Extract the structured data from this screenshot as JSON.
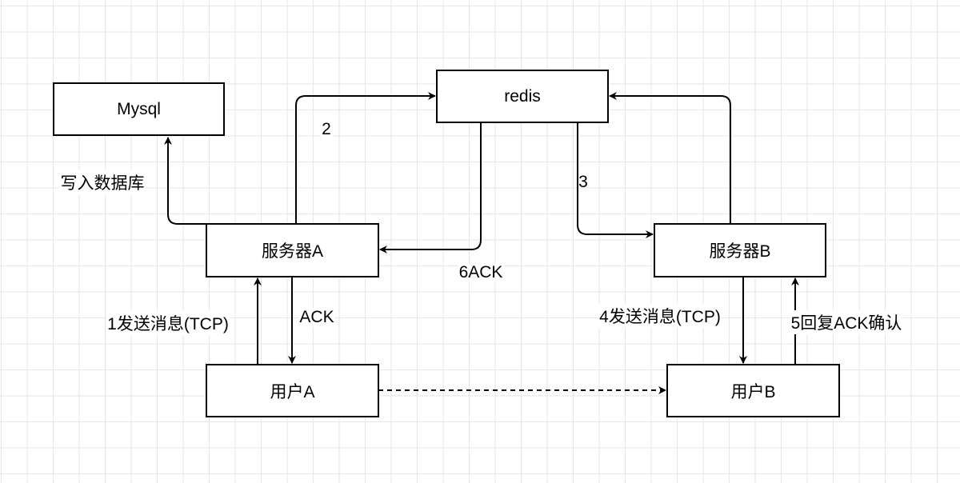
{
  "nodes": {
    "mysql": "Mysql",
    "redis": "redis",
    "server_a": "服务器A",
    "server_b": "服务器B",
    "user_a": "用户A",
    "user_b": "用户B"
  },
  "edge_labels": {
    "write_db": "写入数据库",
    "step2": "2",
    "step3": "3",
    "step6": "6ACK",
    "step1": "1发送消息(TCP)",
    "ack": "ACK",
    "step4": "4发送消息(TCP)",
    "step5": "5回复ACK确认"
  }
}
